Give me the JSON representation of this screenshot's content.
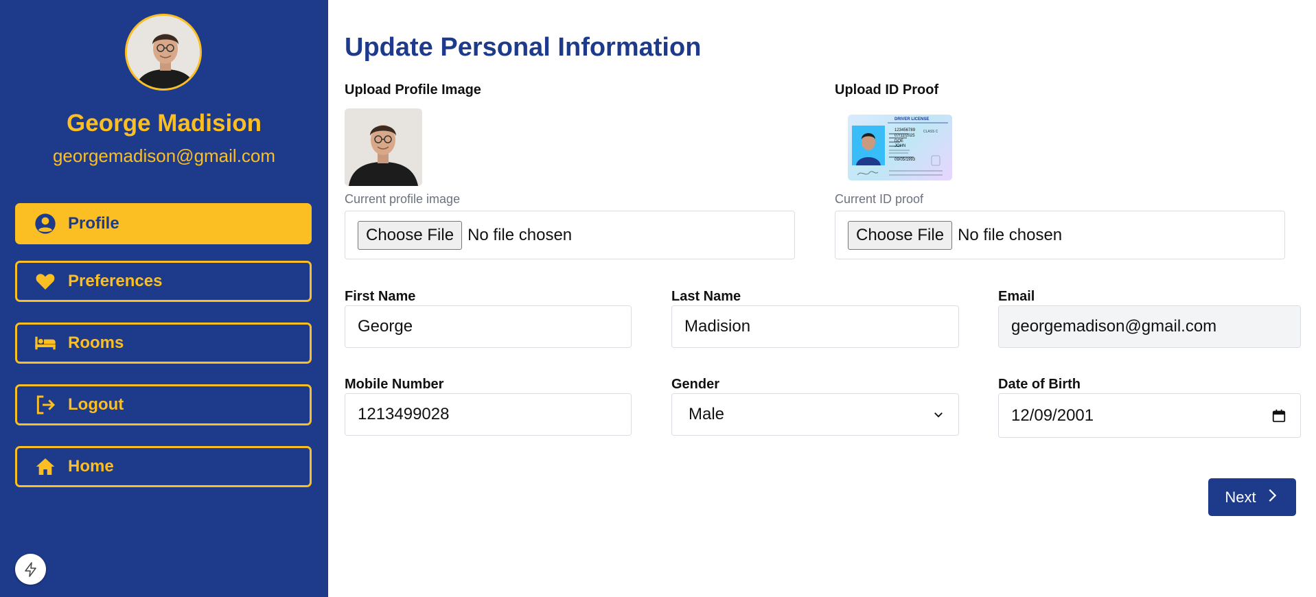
{
  "user": {
    "name": "George Madision",
    "email": "georgemadison@gmail.com"
  },
  "sidebar": {
    "items": [
      {
        "label": "Profile",
        "icon": "user-circle-icon",
        "active": true
      },
      {
        "label": "Preferences",
        "icon": "heart-icon",
        "active": false
      },
      {
        "label": "Rooms",
        "icon": "bed-icon",
        "active": false
      },
      {
        "label": "Logout",
        "icon": "logout-icon",
        "active": false
      },
      {
        "label": "Home",
        "icon": "home-icon",
        "active": false
      }
    ]
  },
  "main": {
    "title": "Update Personal Information",
    "profile_image": {
      "label": "Upload Profile Image",
      "hint": "Current profile image",
      "button": "Choose File",
      "status": "No file chosen"
    },
    "id_proof": {
      "label": "Upload ID Proof",
      "hint": "Current ID proof",
      "button": "Choose File",
      "status": "No file chosen",
      "card": {
        "header": "DRIVER LICENSE",
        "class": "CLASS C",
        "number": "123456789",
        "exp": "07/11/2025",
        "last": "DOE",
        "first": "JOHN",
        "dob": "09/05/1993"
      }
    },
    "fields": {
      "first_name": {
        "label": "First Name",
        "value": "George"
      },
      "last_name": {
        "label": "Last Name",
        "value": "Madision"
      },
      "email": {
        "label": "Email",
        "value": "georgemadison@gmail.com"
      },
      "mobile": {
        "label": "Mobile Number",
        "value": "1213499028"
      },
      "gender": {
        "label": "Gender",
        "value": "Male"
      },
      "dob": {
        "label": "Date of Birth",
        "value": "12/09/2001"
      }
    },
    "next_label": "Next"
  },
  "colors": {
    "brand_blue": "#1e3a8a",
    "accent_yellow": "#fbbf24"
  }
}
